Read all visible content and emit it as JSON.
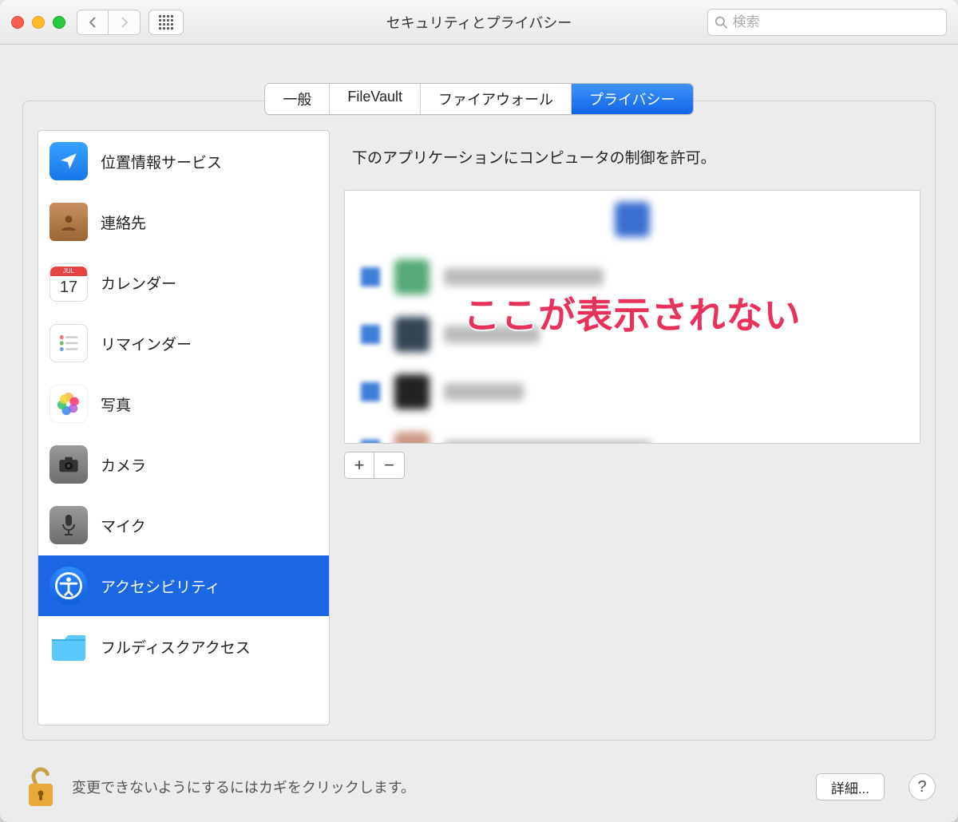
{
  "titlebar": {
    "title": "セキュリティとプライバシー",
    "search_placeholder": "検索"
  },
  "tabs": [
    {
      "label": "一般"
    },
    {
      "label": "FileVault"
    },
    {
      "label": "ファイアウォール"
    },
    {
      "label": "プライバシー",
      "active": true
    }
  ],
  "sidebar": {
    "items": [
      {
        "label": "位置情報サービス",
        "icon": "location"
      },
      {
        "label": "連絡先",
        "icon": "contacts"
      },
      {
        "label": "カレンダー",
        "icon": "calendar",
        "badge": "17"
      },
      {
        "label": "リマインダー",
        "icon": "reminders"
      },
      {
        "label": "写真",
        "icon": "photos"
      },
      {
        "label": "カメラ",
        "icon": "camera"
      },
      {
        "label": "マイク",
        "icon": "mic"
      },
      {
        "label": "アクセシビリティ",
        "icon": "accessibility",
        "selected": true
      },
      {
        "label": "フルディスクアクセス",
        "icon": "folder"
      }
    ]
  },
  "right": {
    "description": "下のアプリケーションにコンピュータの制御を許可。",
    "overlay": "ここが表示されない",
    "add_label": "+",
    "remove_label": "−"
  },
  "footer": {
    "lock_message": "変更できないようにするにはカギをクリックします。",
    "advanced_label": "詳細...",
    "help_label": "?"
  }
}
